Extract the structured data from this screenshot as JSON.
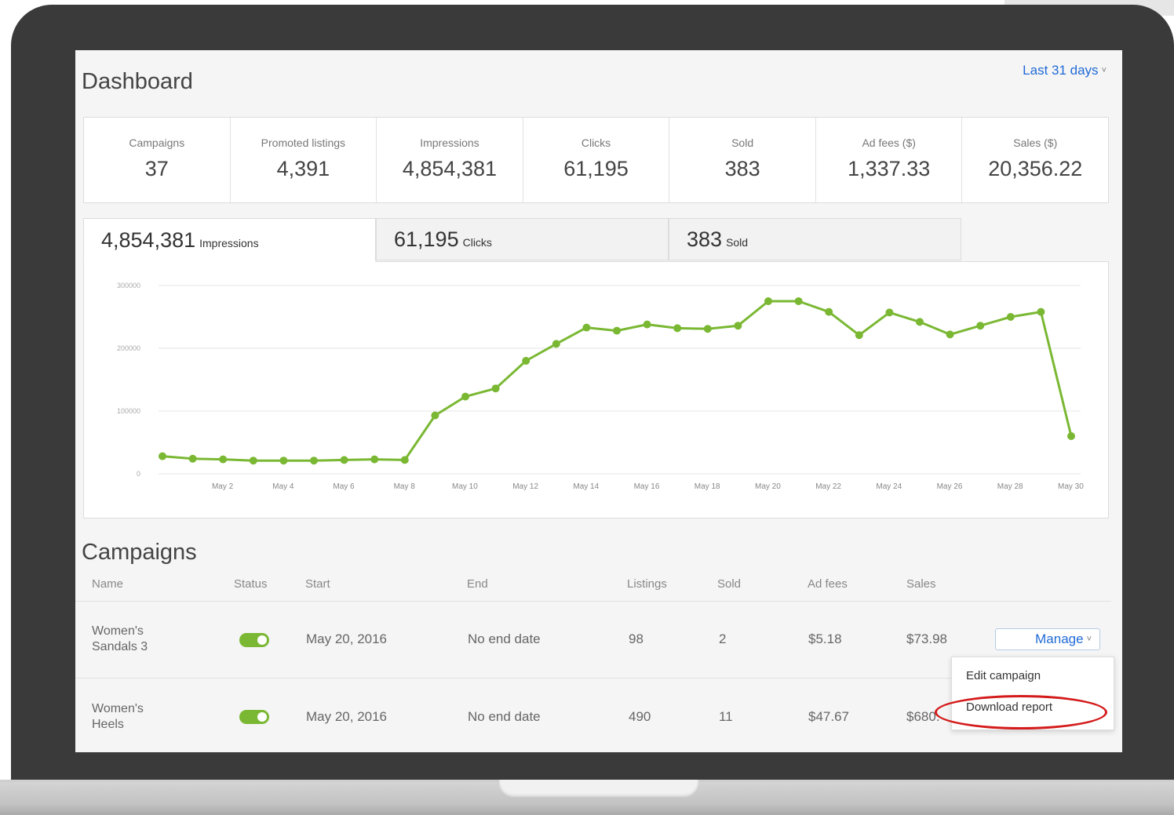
{
  "dashboard": {
    "title": "Dashboard",
    "range_label": "Last 31 days",
    "range_icon": "chevron-down-icon"
  },
  "stats": [
    {
      "label": "Campaigns",
      "value": "37"
    },
    {
      "label": "Promoted listings",
      "value": "4,391"
    },
    {
      "label": "Impressions",
      "value": "4,854,381"
    },
    {
      "label": "Clicks",
      "value": "61,195"
    },
    {
      "label": "Sold",
      "value": "383"
    },
    {
      "label": "Ad fees ($)",
      "value": "1,337.33"
    },
    {
      "label": "Sales ($)",
      "value": "20,356.22"
    }
  ],
  "tabs": [
    {
      "value": "4,854,381",
      "unit": "Impressions"
    },
    {
      "value": "61,195",
      "unit": "Clicks"
    },
    {
      "value": "383",
      "unit": "Sold"
    }
  ],
  "chart_data": {
    "type": "line",
    "x": [
      "May 1",
      "May 2",
      "May 3",
      "May 4",
      "May 5",
      "May 6",
      "May 7",
      "May 8",
      "May 9",
      "May 10",
      "May 11",
      "May 12",
      "May 13",
      "May 14",
      "May 15",
      "May 16",
      "May 17",
      "May 18",
      "May 19",
      "May 20",
      "May 21",
      "May 22",
      "May 23",
      "May 24",
      "May 25",
      "May 26",
      "May 27",
      "May 28",
      "May 29",
      "May 30",
      "May 31"
    ],
    "x_tick_labels": [
      "May 2",
      "May 4",
      "May 6",
      "May 8",
      "May 10",
      "May 12",
      "May 14",
      "May 16",
      "May 18",
      "May 20",
      "May 22",
      "May 24",
      "May 26",
      "May 28",
      "May 30"
    ],
    "series": [
      {
        "values": [
          28000,
          24000,
          23000,
          21000,
          21000,
          21000,
          22000,
          23000,
          22000,
          93000,
          123000,
          136000,
          180000,
          207000,
          233000,
          228000,
          238000,
          232000,
          231000,
          236000,
          275000,
          275000,
          258000,
          221000,
          257000,
          242000,
          222000,
          236000,
          250000,
          258000,
          60000
        ]
      }
    ],
    "y_ticks": [
      "0",
      "100000",
      "200000",
      "300000"
    ],
    "ylim": [
      0,
      300000
    ],
    "grid": true,
    "line_color": "#7ab833"
  },
  "campaigns": {
    "title": "Campaigns",
    "columns": [
      "Name",
      "Status",
      "Start",
      "End",
      "Listings",
      "Sold",
      "Ad fees",
      "Sales"
    ],
    "rows": [
      {
        "name_line1": "Women's",
        "name_line2": "Sandals 3",
        "status": "on",
        "start": "May 20, 2016",
        "end": "No end date",
        "listings": "98",
        "sold": "2",
        "ad_fees": "$5.18",
        "sales": "$73.98"
      },
      {
        "name_line1": "Women's",
        "name_line2": "Heels",
        "status": "on",
        "start": "May 20, 2016",
        "end": "No end date",
        "listings": "490",
        "sold": "11",
        "ad_fees": "$47.67",
        "sales": "$680."
      }
    ],
    "manage_label": "Manage",
    "menu_items": [
      "Edit campaign",
      "Download report"
    ]
  },
  "colors": {
    "accent": "#1f6ad6",
    "toggle_on": "#7ab833",
    "highlight": "#d41a1a"
  }
}
